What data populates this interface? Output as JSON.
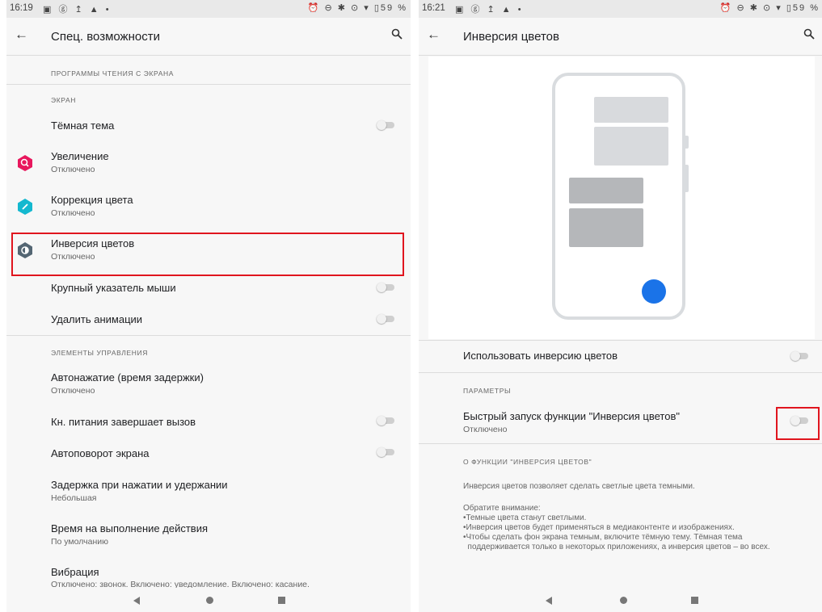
{
  "left": {
    "status": {
      "time": "16:19",
      "left_icons": "▣ ⓖ ↥ ▲ •",
      "right_icons": "⏰ ⊖ ✱ ⊙ ▾ ▯59 %"
    },
    "appbar": {
      "title": "Спец. возможности"
    },
    "sections": {
      "screen_readers": "ПРОГРАММЫ ЧТЕНИЯ С ЭКРАНА",
      "screen": "ЭКРАН",
      "controls": "ЭЛЕМЕНТЫ УПРАВЛЕНИЯ"
    },
    "items": {
      "dark_theme": "Тёмная тема",
      "magnification": {
        "title": "Увеличение",
        "sub": "Отключено"
      },
      "color_correction": {
        "title": "Коррекция цвета",
        "sub": "Отключено"
      },
      "color_inversion": {
        "title": "Инверсия цветов",
        "sub": "Отключено"
      },
      "large_pointer": "Крупный указатель мыши",
      "remove_animations": "Удалить анимации",
      "autoclick": {
        "title": "Автонажатие (время задержки)",
        "sub": "Отключено"
      },
      "power_ends_call": "Кн. питания завершает вызов",
      "autorotate": "Автоповорот экрана",
      "touch_hold_delay": {
        "title": "Задержка при нажатии и удержании",
        "sub": "Небольшая"
      },
      "time_to_act": {
        "title": "Время на выполнение действия",
        "sub": "По умолчанию"
      },
      "vibration": {
        "title": "Вибрация",
        "sub": "Отключено: звонок. Включено: уведомление. Включено: касание."
      }
    }
  },
  "right": {
    "status": {
      "time": "16:21",
      "left_icons": "▣ ⓖ ↥ ▲ •",
      "right_icons": "⏰ ⊖ ✱ ⊙ ▾ ▯59 %"
    },
    "appbar": {
      "title": "Инверсия цветов"
    },
    "use_inversion": "Использовать инверсию цветов",
    "section_params": "ПАРАМЕТРЫ",
    "shortcut": {
      "title": "Быстрый запуск функции \"Инверсия цветов\"",
      "sub": "Отключено"
    },
    "about_section": "О ФУНКЦИИ \"ИНВЕРСИЯ ЦВЕТОВ\"",
    "about_p1": "Инверсия цветов позволяет сделать светлые цвета темными.",
    "about_p2": "Обратите внимание:\n•Темные цвета станут светлыми.\n•Инверсия цветов будет применяться в медиаконтенте и изображениях.\n•Чтобы сделать фон экрана темным, включите тёмную тему. Тёмная тема\n  поддерживается только в некоторых приложениях, а инверсия цветов – во всех."
  },
  "colors": {
    "highlight": "#e0151e",
    "magnification_icon": "#e8175d",
    "color_correction_icon": "#14b8cf",
    "color_inversion_icon": "#546673",
    "fab": "#1a73e8"
  },
  "toggles": {
    "dark_theme": false,
    "large_pointer": false,
    "remove_animations": false,
    "power_ends_call": false,
    "autorotate": false,
    "use_inversion": false,
    "shortcut": false
  }
}
